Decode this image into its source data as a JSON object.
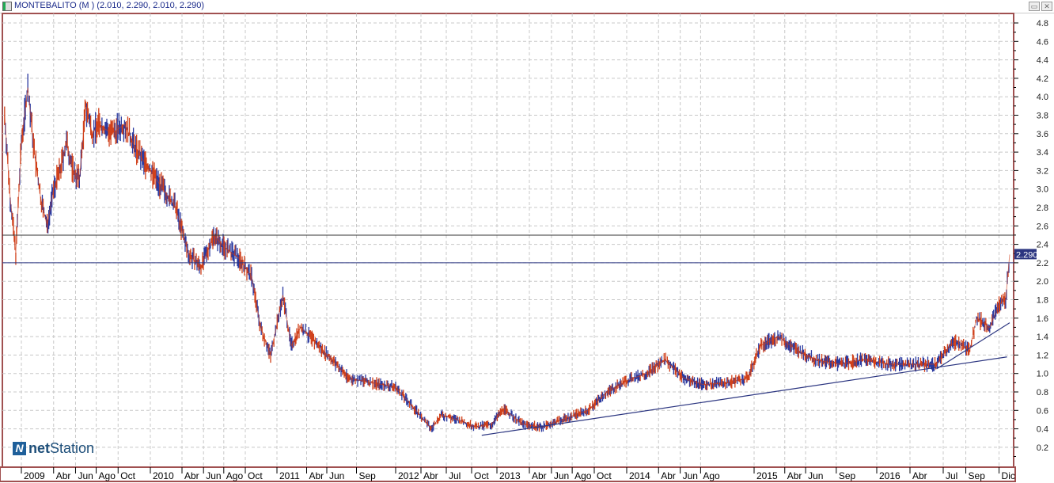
{
  "window": {
    "title": "MONTEBALITO (M ) (2.010, 2.290, 2.010, 2.290)",
    "minimize": "▭",
    "close": "✕"
  },
  "logo": {
    "mark": "N",
    "brand_bold": "net",
    "brand": "Station"
  },
  "chart_data": {
    "type": "line",
    "title": "MONTEBALITO (M )",
    "last_value_label": "2.290",
    "ylim": [
      0,
      4.9
    ],
    "y_ticks": [
      "0.2",
      "0.4",
      "0.6",
      "0.8",
      "1.0",
      "1.2",
      "1.4",
      "1.6",
      "1.8",
      "2.0",
      "2.2",
      "2.4",
      "2.6",
      "2.8",
      "3.0",
      "3.2",
      "3.4",
      "3.6",
      "3.8",
      "4.0",
      "4.2",
      "4.4",
      "4.6",
      "4.8"
    ],
    "x_labels": [
      {
        "t": 2009.0,
        "l": "2009"
      },
      {
        "t": 2009.25,
        "l": "Abr"
      },
      {
        "t": 2009.42,
        "l": "Jun"
      },
      {
        "t": 2009.58,
        "l": "Ago"
      },
      {
        "t": 2009.75,
        "l": "Oct"
      },
      {
        "t": 2010.0,
        "l": "2010"
      },
      {
        "t": 2010.25,
        "l": "Abr"
      },
      {
        "t": 2010.42,
        "l": "Jun"
      },
      {
        "t": 2010.58,
        "l": "Ago"
      },
      {
        "t": 2010.75,
        "l": "Oct"
      },
      {
        "t": 2011.0,
        "l": "2011"
      },
      {
        "t": 2011.25,
        "l": "Abr"
      },
      {
        "t": 2011.42,
        "l": "Jun"
      },
      {
        "t": 2011.67,
        "l": "Sep"
      },
      {
        "t": 2012.0,
        "l": "2012"
      },
      {
        "t": 2012.25,
        "l": "Abr"
      },
      {
        "t": 2012.5,
        "l": "Jul"
      },
      {
        "t": 2012.75,
        "l": "Oct"
      },
      {
        "t": 2013.0,
        "l": "2013"
      },
      {
        "t": 2013.25,
        "l": "Abr"
      },
      {
        "t": 2013.42,
        "l": "Jun"
      },
      {
        "t": 2013.58,
        "l": "Ago"
      },
      {
        "t": 2013.75,
        "l": "Oct"
      },
      {
        "t": 2014.0,
        "l": "2014"
      },
      {
        "t": 2014.25,
        "l": "Abr"
      },
      {
        "t": 2014.42,
        "l": "Jun"
      },
      {
        "t": 2014.58,
        "l": "Ago"
      },
      {
        "t": 2015.0,
        "l": "2015"
      },
      {
        "t": 2015.25,
        "l": "Abr"
      },
      {
        "t": 2015.42,
        "l": "Jun"
      },
      {
        "t": 2015.67,
        "l": "Sep"
      },
      {
        "t": 2016.0,
        "l": "2016"
      },
      {
        "t": 2016.25,
        "l": "Abr"
      },
      {
        "t": 2016.5,
        "l": "Jul"
      },
      {
        "t": 2016.67,
        "l": "Sep"
      },
      {
        "t": 2016.92,
        "l": "Dic"
      }
    ],
    "price": [
      [
        2008.85,
        3.8
      ],
      [
        2008.9,
        2.9
      ],
      [
        2008.95,
        2.3
      ],
      [
        2009.0,
        3.5
      ],
      [
        2009.05,
        4.1
      ],
      [
        2009.1,
        3.4
      ],
      [
        2009.15,
        2.9
      ],
      [
        2009.2,
        2.6
      ],
      [
        2009.25,
        3.0
      ],
      [
        2009.3,
        3.2
      ],
      [
        2009.35,
        3.5
      ],
      [
        2009.4,
        3.2
      ],
      [
        2009.45,
        3.1
      ],
      [
        2009.5,
        3.9
      ],
      [
        2009.55,
        3.6
      ],
      [
        2009.6,
        3.7
      ],
      [
        2009.7,
        3.6
      ],
      [
        2009.8,
        3.7
      ],
      [
        2009.9,
        3.4
      ],
      [
        2010.0,
        3.2
      ],
      [
        2010.1,
        3.0
      ],
      [
        2010.2,
        2.8
      ],
      [
        2010.3,
        2.3
      ],
      [
        2010.4,
        2.15
      ],
      [
        2010.5,
        2.5
      ],
      [
        2010.6,
        2.35
      ],
      [
        2010.7,
        2.25
      ],
      [
        2010.8,
        2.05
      ],
      [
        2010.87,
        1.5
      ],
      [
        2010.95,
        1.2
      ],
      [
        2011.05,
        1.85
      ],
      [
        2011.12,
        1.3
      ],
      [
        2011.2,
        1.5
      ],
      [
        2011.35,
        1.3
      ],
      [
        2011.5,
        1.1
      ],
      [
        2011.6,
        0.95
      ],
      [
        2011.8,
        0.9
      ],
      [
        2012.0,
        0.85
      ],
      [
        2012.2,
        0.6
      ],
      [
        2012.35,
        0.4
      ],
      [
        2012.45,
        0.55
      ],
      [
        2012.6,
        0.5
      ],
      [
        2012.8,
        0.42
      ],
      [
        2012.95,
        0.45
      ],
      [
        2013.05,
        0.62
      ],
      [
        2013.2,
        0.45
      ],
      [
        2013.35,
        0.42
      ],
      [
        2013.5,
        0.5
      ],
      [
        2013.7,
        0.6
      ],
      [
        2013.85,
        0.8
      ],
      [
        2014.0,
        0.92
      ],
      [
        2014.15,
        1.0
      ],
      [
        2014.3,
        1.15
      ],
      [
        2014.45,
        0.95
      ],
      [
        2014.6,
        0.88
      ],
      [
        2014.8,
        0.9
      ],
      [
        2014.95,
        0.95
      ],
      [
        2015.05,
        1.3
      ],
      [
        2015.2,
        1.4
      ],
      [
        2015.35,
        1.25
      ],
      [
        2015.5,
        1.15
      ],
      [
        2015.7,
        1.1
      ],
      [
        2015.9,
        1.15
      ],
      [
        2016.1,
        1.1
      ],
      [
        2016.3,
        1.1
      ],
      [
        2016.45,
        1.1
      ],
      [
        2016.55,
        1.3
      ],
      [
        2016.6,
        1.35
      ],
      [
        2016.7,
        1.25
      ],
      [
        2016.75,
        1.6
      ],
      [
        2016.85,
        1.5
      ],
      [
        2016.92,
        1.75
      ],
      [
        2016.97,
        1.8
      ],
      [
        2017.0,
        2.29
      ]
    ],
    "horizontal_lines": [
      2.5,
      2.2
    ],
    "trendlines": [
      [
        [
          2012.85,
          0.33
        ],
        [
          2016.98,
          1.18
        ]
      ],
      [
        [
          2016.45,
          1.05
        ],
        [
          2017.0,
          1.55
        ]
      ]
    ],
    "colors": {
      "up": "#2b3aa0",
      "down": "#d0401a",
      "line": "#2b3580",
      "grid": "#c8c8c8",
      "frame": "#a05050"
    }
  }
}
